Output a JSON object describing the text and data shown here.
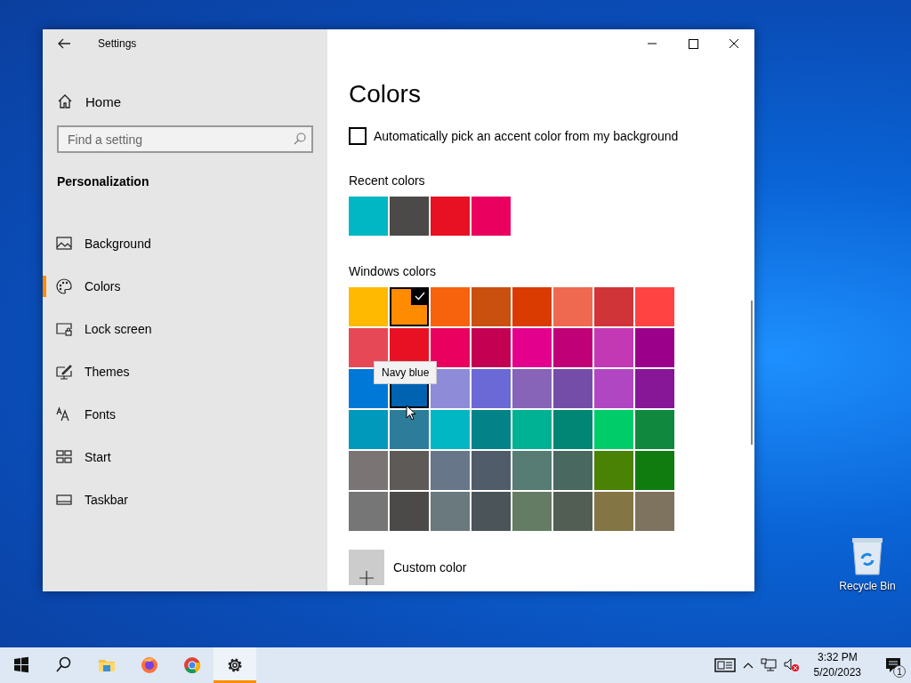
{
  "desktop": {
    "icons": [
      {
        "label": "Recycle Bin"
      }
    ]
  },
  "window": {
    "title": "Settings"
  },
  "sidebar": {
    "home": "Home",
    "search": {
      "placeholder": "Find a setting"
    },
    "section": "Personalization",
    "items": [
      {
        "label": "Background",
        "kind": "background",
        "selected": false
      },
      {
        "label": "Colors",
        "kind": "colors",
        "selected": true
      },
      {
        "label": "Lock screen",
        "kind": "lock",
        "selected": false
      },
      {
        "label": "Themes",
        "kind": "themes",
        "selected": false
      },
      {
        "label": "Fonts",
        "kind": "fonts",
        "selected": false
      },
      {
        "label": "Start",
        "kind": "start",
        "selected": false
      },
      {
        "label": "Taskbar",
        "kind": "taskbar",
        "selected": false
      }
    ]
  },
  "page": {
    "title": "Colors",
    "auto_pick": {
      "label": "Automatically pick an accent color from my background",
      "checked": false
    },
    "recent_colors": {
      "label": "Recent colors",
      "swatches": [
        {
          "color": "#00b7c3"
        },
        {
          "color": "#4c4a48"
        },
        {
          "color": "#e81123"
        },
        {
          "color": "#ea005e"
        }
      ]
    },
    "windows_colors": {
      "label": "Windows colors",
      "tooltip": "Navy blue",
      "swatches": [
        {
          "color": "#ffb900",
          "selected": false,
          "hovered": false
        },
        {
          "color": "#ff8c00",
          "selected": true,
          "hovered": false
        },
        {
          "color": "#f7630c",
          "selected": false,
          "hovered": false
        },
        {
          "color": "#ca5010",
          "selected": false,
          "hovered": false
        },
        {
          "color": "#da3b01",
          "selected": false,
          "hovered": false
        },
        {
          "color": "#ef6950",
          "selected": false,
          "hovered": false
        },
        {
          "color": "#d13438",
          "selected": false,
          "hovered": false
        },
        {
          "color": "#ff4343",
          "selected": false,
          "hovered": false
        },
        {
          "color": "#e74856",
          "selected": false,
          "hovered": false
        },
        {
          "color": "#e81123",
          "selected": false,
          "hovered": false
        },
        {
          "color": "#ea005e",
          "selected": false,
          "hovered": false
        },
        {
          "color": "#c30052",
          "selected": false,
          "hovered": false
        },
        {
          "color": "#e3008c",
          "selected": false,
          "hovered": false
        },
        {
          "color": "#bf0077",
          "selected": false,
          "hovered": false
        },
        {
          "color": "#c239b3",
          "selected": false,
          "hovered": false
        },
        {
          "color": "#9a0089",
          "selected": false,
          "hovered": false
        },
        {
          "color": "#0078d7",
          "selected": false,
          "hovered": false
        },
        {
          "color": "#0063b1",
          "selected": false,
          "hovered": true
        },
        {
          "color": "#8e8cd8",
          "selected": false,
          "hovered": false
        },
        {
          "color": "#6b69d6",
          "selected": false,
          "hovered": false
        },
        {
          "color": "#8764b8",
          "selected": false,
          "hovered": false
        },
        {
          "color": "#744da9",
          "selected": false,
          "hovered": false
        },
        {
          "color": "#b146c2",
          "selected": false,
          "hovered": false
        },
        {
          "color": "#881798",
          "selected": false,
          "hovered": false
        },
        {
          "color": "#0099bc",
          "selected": false,
          "hovered": false
        },
        {
          "color": "#2d7d9a",
          "selected": false,
          "hovered": false
        },
        {
          "color": "#00b7c3",
          "selected": false,
          "hovered": false
        },
        {
          "color": "#038387",
          "selected": false,
          "hovered": false
        },
        {
          "color": "#00b294",
          "selected": false,
          "hovered": false
        },
        {
          "color": "#018574",
          "selected": false,
          "hovered": false
        },
        {
          "color": "#00cc6a",
          "selected": false,
          "hovered": false
        },
        {
          "color": "#10893e",
          "selected": false,
          "hovered": false
        },
        {
          "color": "#7a7574",
          "selected": false,
          "hovered": false
        },
        {
          "color": "#5d5a58",
          "selected": false,
          "hovered": false
        },
        {
          "color": "#68768a",
          "selected": false,
          "hovered": false
        },
        {
          "color": "#515c6b",
          "selected": false,
          "hovered": false
        },
        {
          "color": "#567c73",
          "selected": false,
          "hovered": false
        },
        {
          "color": "#486860",
          "selected": false,
          "hovered": false
        },
        {
          "color": "#498205",
          "selected": false,
          "hovered": false
        },
        {
          "color": "#107c10",
          "selected": false,
          "hovered": false
        },
        {
          "color": "#767676",
          "selected": false,
          "hovered": false
        },
        {
          "color": "#4c4a48",
          "selected": false,
          "hovered": false
        },
        {
          "color": "#69797e",
          "selected": false,
          "hovered": false
        },
        {
          "color": "#4a5459",
          "selected": false,
          "hovered": false
        },
        {
          "color": "#647c64",
          "selected": false,
          "hovered": false
        },
        {
          "color": "#525e54",
          "selected": false,
          "hovered": false
        },
        {
          "color": "#847545",
          "selected": false,
          "hovered": false
        },
        {
          "color": "#7e735f",
          "selected": false,
          "hovered": false
        }
      ]
    },
    "custom_color": "Custom color"
  },
  "taskbar": {
    "apps": [
      {
        "kind": "start",
        "active": false
      },
      {
        "kind": "search",
        "active": false
      },
      {
        "kind": "explorer",
        "active": false
      },
      {
        "kind": "firefox",
        "active": false
      },
      {
        "kind": "chrome",
        "active": false
      },
      {
        "kind": "settings",
        "active": true
      }
    ],
    "time": "3:32 PM",
    "date": "5/20/2023",
    "notifications": "1"
  }
}
